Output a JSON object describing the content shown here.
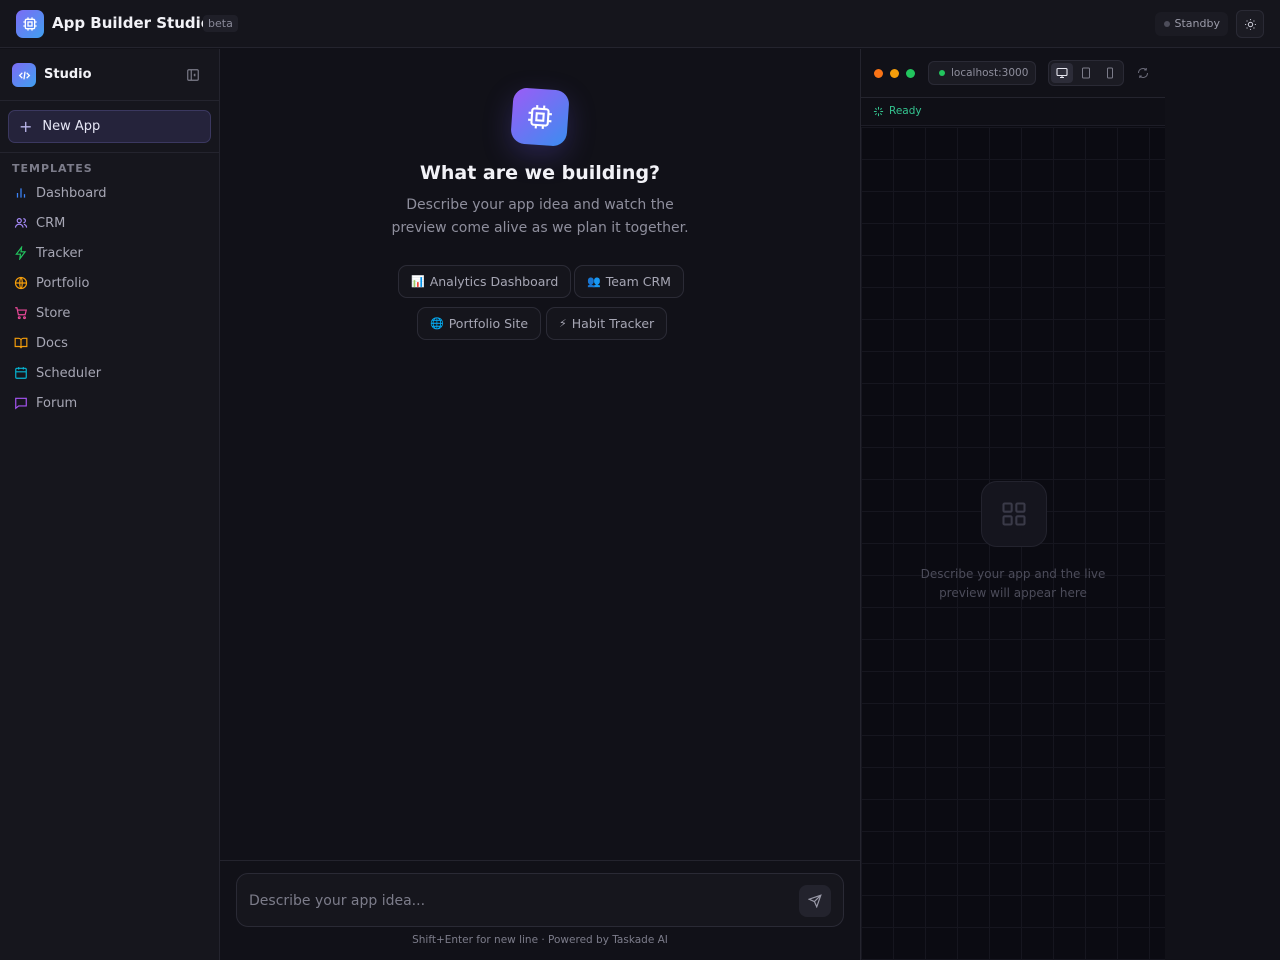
{
  "header": {
    "app_title": "App Builder Studio",
    "badge": "beta",
    "status": "Standby",
    "icons": {
      "logo": "chip-icon",
      "theme": "sun-icon"
    }
  },
  "sidebar": {
    "title": "Studio",
    "new_app_label": "New App",
    "section_label": "TEMPLATES",
    "items": [
      {
        "label": "Dashboard",
        "icon": "bar-chart-icon",
        "color": "#3b82f6"
      },
      {
        "label": "CRM",
        "icon": "users-icon",
        "color": "#a78bfa"
      },
      {
        "label": "Tracker",
        "icon": "zap-icon",
        "color": "#22c55e"
      },
      {
        "label": "Portfolio",
        "icon": "globe-icon",
        "color": "#f59e0b"
      },
      {
        "label": "Store",
        "icon": "cart-icon",
        "color": "#ec4899"
      },
      {
        "label": "Docs",
        "icon": "book-icon",
        "color": "#f59e0b"
      },
      {
        "label": "Scheduler",
        "icon": "calendar-icon",
        "color": "#06b6d4"
      },
      {
        "label": "Forum",
        "icon": "message-icon",
        "color": "#a855f7"
      }
    ]
  },
  "chat": {
    "title": "What are we building?",
    "subtitle": "Describe your app idea and watch the preview come alive as we plan it together.",
    "suggestions": [
      {
        "emoji": "📊",
        "label": "Analytics Dashboard"
      },
      {
        "emoji": "👥",
        "label": "Team CRM"
      },
      {
        "emoji": "🌐",
        "label": "Portfolio Site"
      },
      {
        "emoji": "⚡",
        "label": "Habit Tracker"
      }
    ],
    "input_placeholder": "Describe your app idea...",
    "hint": "Shift+Enter for new line · Powered by Taskade AI"
  },
  "preview": {
    "url": "localhost:3000",
    "status": "Ready",
    "empty_text": "Describe your app and the live preview will appear here",
    "colors": {
      "red_dot": "#f97316",
      "yellow_dot": "#f59e0b",
      "green_dot": "#22c55e",
      "ready": "#34c38f"
    }
  }
}
